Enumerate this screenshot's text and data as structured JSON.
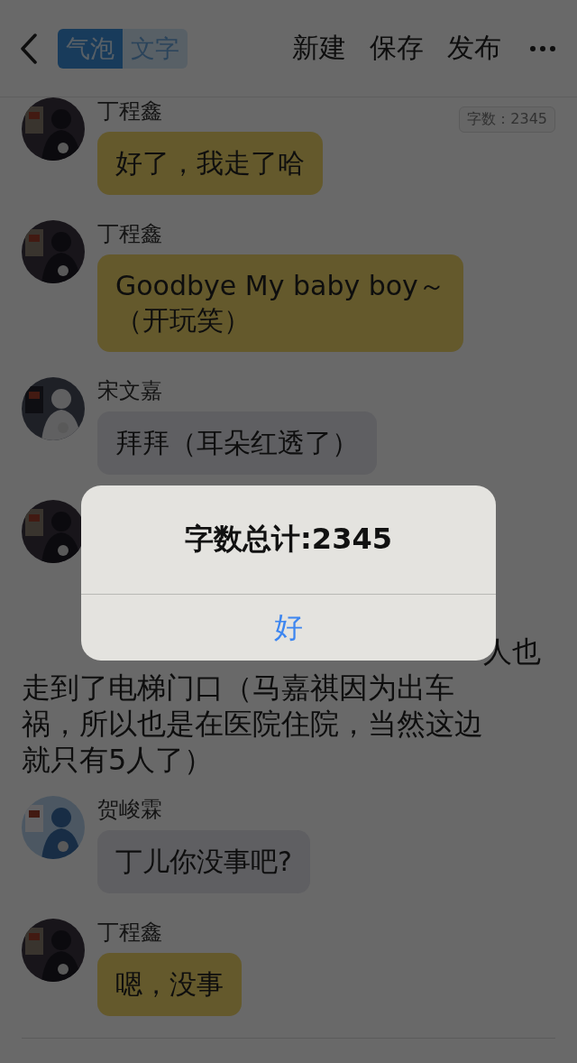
{
  "header": {
    "mode_tabs": [
      {
        "label": "气泡",
        "selected": true
      },
      {
        "label": "文字",
        "selected": false
      }
    ],
    "actions": [
      "新建",
      "保存",
      "发布"
    ]
  },
  "word_count_tag": "字数：2345",
  "messages": [
    {
      "kind": "bubble",
      "sender": "丁程鑫",
      "lines": [
        "好了，我走了哈"
      ],
      "color": "#64592c"
    },
    {
      "kind": "bubble",
      "sender": "丁程鑫",
      "lines": [
        "Goodbye My baby boy～",
        "（开玩笑）"
      ],
      "color": "#64592c"
    },
    {
      "kind": "bubble",
      "sender": "宋文嘉",
      "lines": [
        "拜拜（耳朵红透了）"
      ],
      "color": "#5f5f62"
    },
    {
      "kind": "covered"
    },
    {
      "kind": "narration",
      "tail": "人也",
      "lines": [
        "走到了电梯门口（马嘉祺因为出车",
        "祸，所以也是在医院住院，当然这边",
        "就只有5人了）"
      ]
    },
    {
      "kind": "bubble",
      "sender": "贺峻霖",
      "lines": [
        "丁儿你没事吧?"
      ],
      "color": "#5f5f62"
    },
    {
      "kind": "bubble",
      "sender": "丁程鑫",
      "lines": [
        "嗯，没事"
      ],
      "color": "#64592c"
    }
  ],
  "dialog": {
    "message": "字数总计:2345",
    "button": "好"
  }
}
